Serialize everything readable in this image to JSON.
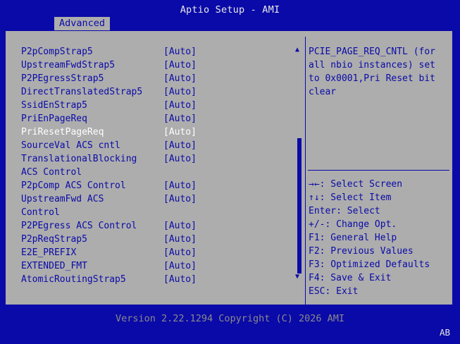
{
  "app": {
    "title": "Aptio Setup - AMI",
    "tab": "Advanced",
    "footer": "Version 2.22.1294 Copyright (C) 2026 AMI",
    "corner_badge": "AB"
  },
  "colors": {
    "background": "#0a0aa8",
    "panel": "#adadad",
    "text": "#0a0aa8",
    "selected_text": "#ffffff",
    "footer_text": "#8a8a8a"
  },
  "settings": [
    {
      "label": "P2pCompStrap5",
      "value": "[Auto]"
    },
    {
      "label": "UpstreamFwdStrap5",
      "value": "[Auto]"
    },
    {
      "label": "P2PEgressStrap5",
      "value": "[Auto]"
    },
    {
      "label": "DirectTranslatedStrap5",
      "value": "[Auto]"
    },
    {
      "label": "SsidEnStrap5",
      "value": "[Auto]"
    },
    {
      "label": "PriEnPageReq",
      "value": "[Auto]"
    },
    {
      "label": "PriResetPageReq",
      "value": "[Auto]",
      "selected": true
    },
    {
      "label": "SourceVal ACS cntl",
      "value": "[Auto]"
    },
    {
      "label": "TranslationalBlocking",
      "value": "[Auto]"
    },
    {
      "label": "ACS Control",
      "value": ""
    },
    {
      "label": "P2pComp ACS Control",
      "value": "[Auto]"
    },
    {
      "label": "UpstreamFwd ACS",
      "value": "[Auto]"
    },
    {
      "label": "Control",
      "value": ""
    },
    {
      "label": "P2PEgress ACS Control",
      "value": "[Auto]"
    },
    {
      "label": "P2pReqStrap5",
      "value": "[Auto]"
    },
    {
      "label": "E2E_PREFIX",
      "value": "[Auto]"
    },
    {
      "label": "EXTENDED_FMT",
      "value": "[Auto]"
    },
    {
      "label": "AtomicRoutingStrap5",
      "value": "[Auto]"
    }
  ],
  "help_text": "PCIE_PAGE_REQ_CNTL (for\nall nbio instances) set\nto 0x0001,Pri Reset bit\nclear",
  "scroll": {
    "up_glyph": "▲",
    "down_glyph": "▼"
  },
  "keys": [
    "→←: Select Screen",
    "↑↓: Select Item",
    "Enter: Select",
    "+/-: Change Opt.",
    "F1: General Help",
    "F2: Previous Values",
    "F3: Optimized Defaults",
    "F4: Save & Exit",
    "ESC: Exit"
  ]
}
